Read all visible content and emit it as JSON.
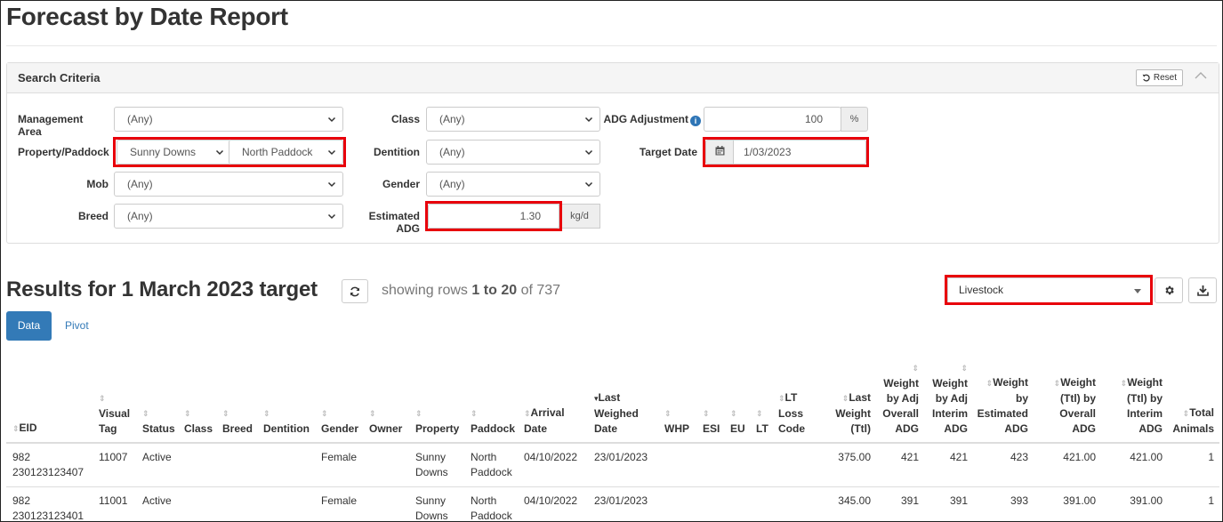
{
  "page": {
    "title": "Forecast by Date Report"
  },
  "search": {
    "title": "Search Criteria",
    "reset_label": "Reset",
    "fields": {
      "management_area": {
        "label": "Management Area",
        "value": "(Any)"
      },
      "property_paddock": {
        "label": "Property/Paddock",
        "property": "Sunny Downs",
        "paddock": "North Paddock"
      },
      "mob": {
        "label": "Mob",
        "value": "(Any)"
      },
      "breed": {
        "label": "Breed",
        "value": "(Any)"
      },
      "class": {
        "label": "Class",
        "value": "(Any)"
      },
      "dentition": {
        "label": "Dentition",
        "value": "(Any)"
      },
      "gender": {
        "label": "Gender",
        "value": "(Any)"
      },
      "estimated_adg": {
        "label": "Estimated ADG",
        "value": "1.30",
        "unit": "kg/d"
      },
      "adg_adjustment": {
        "label": "ADG Adjustment",
        "value": "100",
        "unit": "%"
      },
      "target_date": {
        "label": "Target Date",
        "value": "1/03/2023"
      }
    }
  },
  "results": {
    "title": "Results for 1 March 2023 target",
    "showing_prefix": "showing rows",
    "row_from": "1",
    "to_word": "to",
    "row_to": "20",
    "of_word": "of",
    "total": "737",
    "view_select": "Livestock",
    "tabs": {
      "data": "Data",
      "pivot": "Pivot"
    }
  },
  "table": {
    "headers": {
      "eid": "EID",
      "visual_tag_1": "Visual",
      "visual_tag_2": "Tag",
      "status": "Status",
      "class": "Class",
      "breed": "Breed",
      "dentition": "Dentition",
      "gender": "Gender",
      "owner": "Owner",
      "property": "Property",
      "paddock": "Paddock",
      "arrival_1": "Arrival",
      "arrival_2": "Date",
      "lwd_1": "Last",
      "lwd_2": "Weighed",
      "lwd_3": "Date",
      "whp": "WHP",
      "esi": "ESI",
      "eu": "EU",
      "lt": "LT",
      "ltl_1": "LT",
      "ltl_2": "Loss",
      "ltl_3": "Code",
      "lw_1": "Last",
      "lw_2": "Weight",
      "lw_3": "(Ttl)",
      "wao_1": "Weight",
      "wao_2": "by Adj",
      "wao_3": "Overall",
      "wao_4": "ADG",
      "wai_1": "Weight",
      "wai_2": "by Adj",
      "wai_3": "Interim",
      "wai_4": "ADG",
      "wbe_1": "Weight",
      "wbe_2": "by",
      "wbe_3": "Estimated",
      "wbe_4": "ADG",
      "wto_1": "Weight",
      "wto_2": "(Ttl) by",
      "wto_3": "Overall",
      "wto_4": "ADG",
      "wti_1": "Weight",
      "wti_2": "(Ttl) by",
      "wti_3": "Interim",
      "wti_4": "ADG",
      "ta_1": "Total",
      "ta_2": "Animals"
    },
    "rows": [
      {
        "eid_1": "982",
        "eid_2": "230123123407",
        "visual_tag": "11007",
        "status": "Active",
        "gender": "Female",
        "property_1": "Sunny",
        "property_2": "Downs",
        "paddock_1": "North",
        "paddock_2": "Paddock",
        "arrival": "04/10/2022",
        "last_weighed": "23/01/2023",
        "last_weight": "375.00",
        "wao": "421",
        "wai": "421",
        "wbe": "423",
        "wto": "421.00",
        "wti": "421.00",
        "total": "1"
      },
      {
        "eid_1": "982",
        "eid_2": "230123123401",
        "visual_tag": "11001",
        "status": "Active",
        "gender": "Female",
        "property_1": "Sunny",
        "property_2": "Downs",
        "paddock_1": "North",
        "paddock_2": "Paddock",
        "arrival": "04/10/2022",
        "last_weighed": "23/01/2023",
        "last_weight": "345.00",
        "wao": "391",
        "wai": "391",
        "wbe": "393",
        "wto": "391.00",
        "wti": "391.00",
        "total": "1"
      }
    ]
  }
}
